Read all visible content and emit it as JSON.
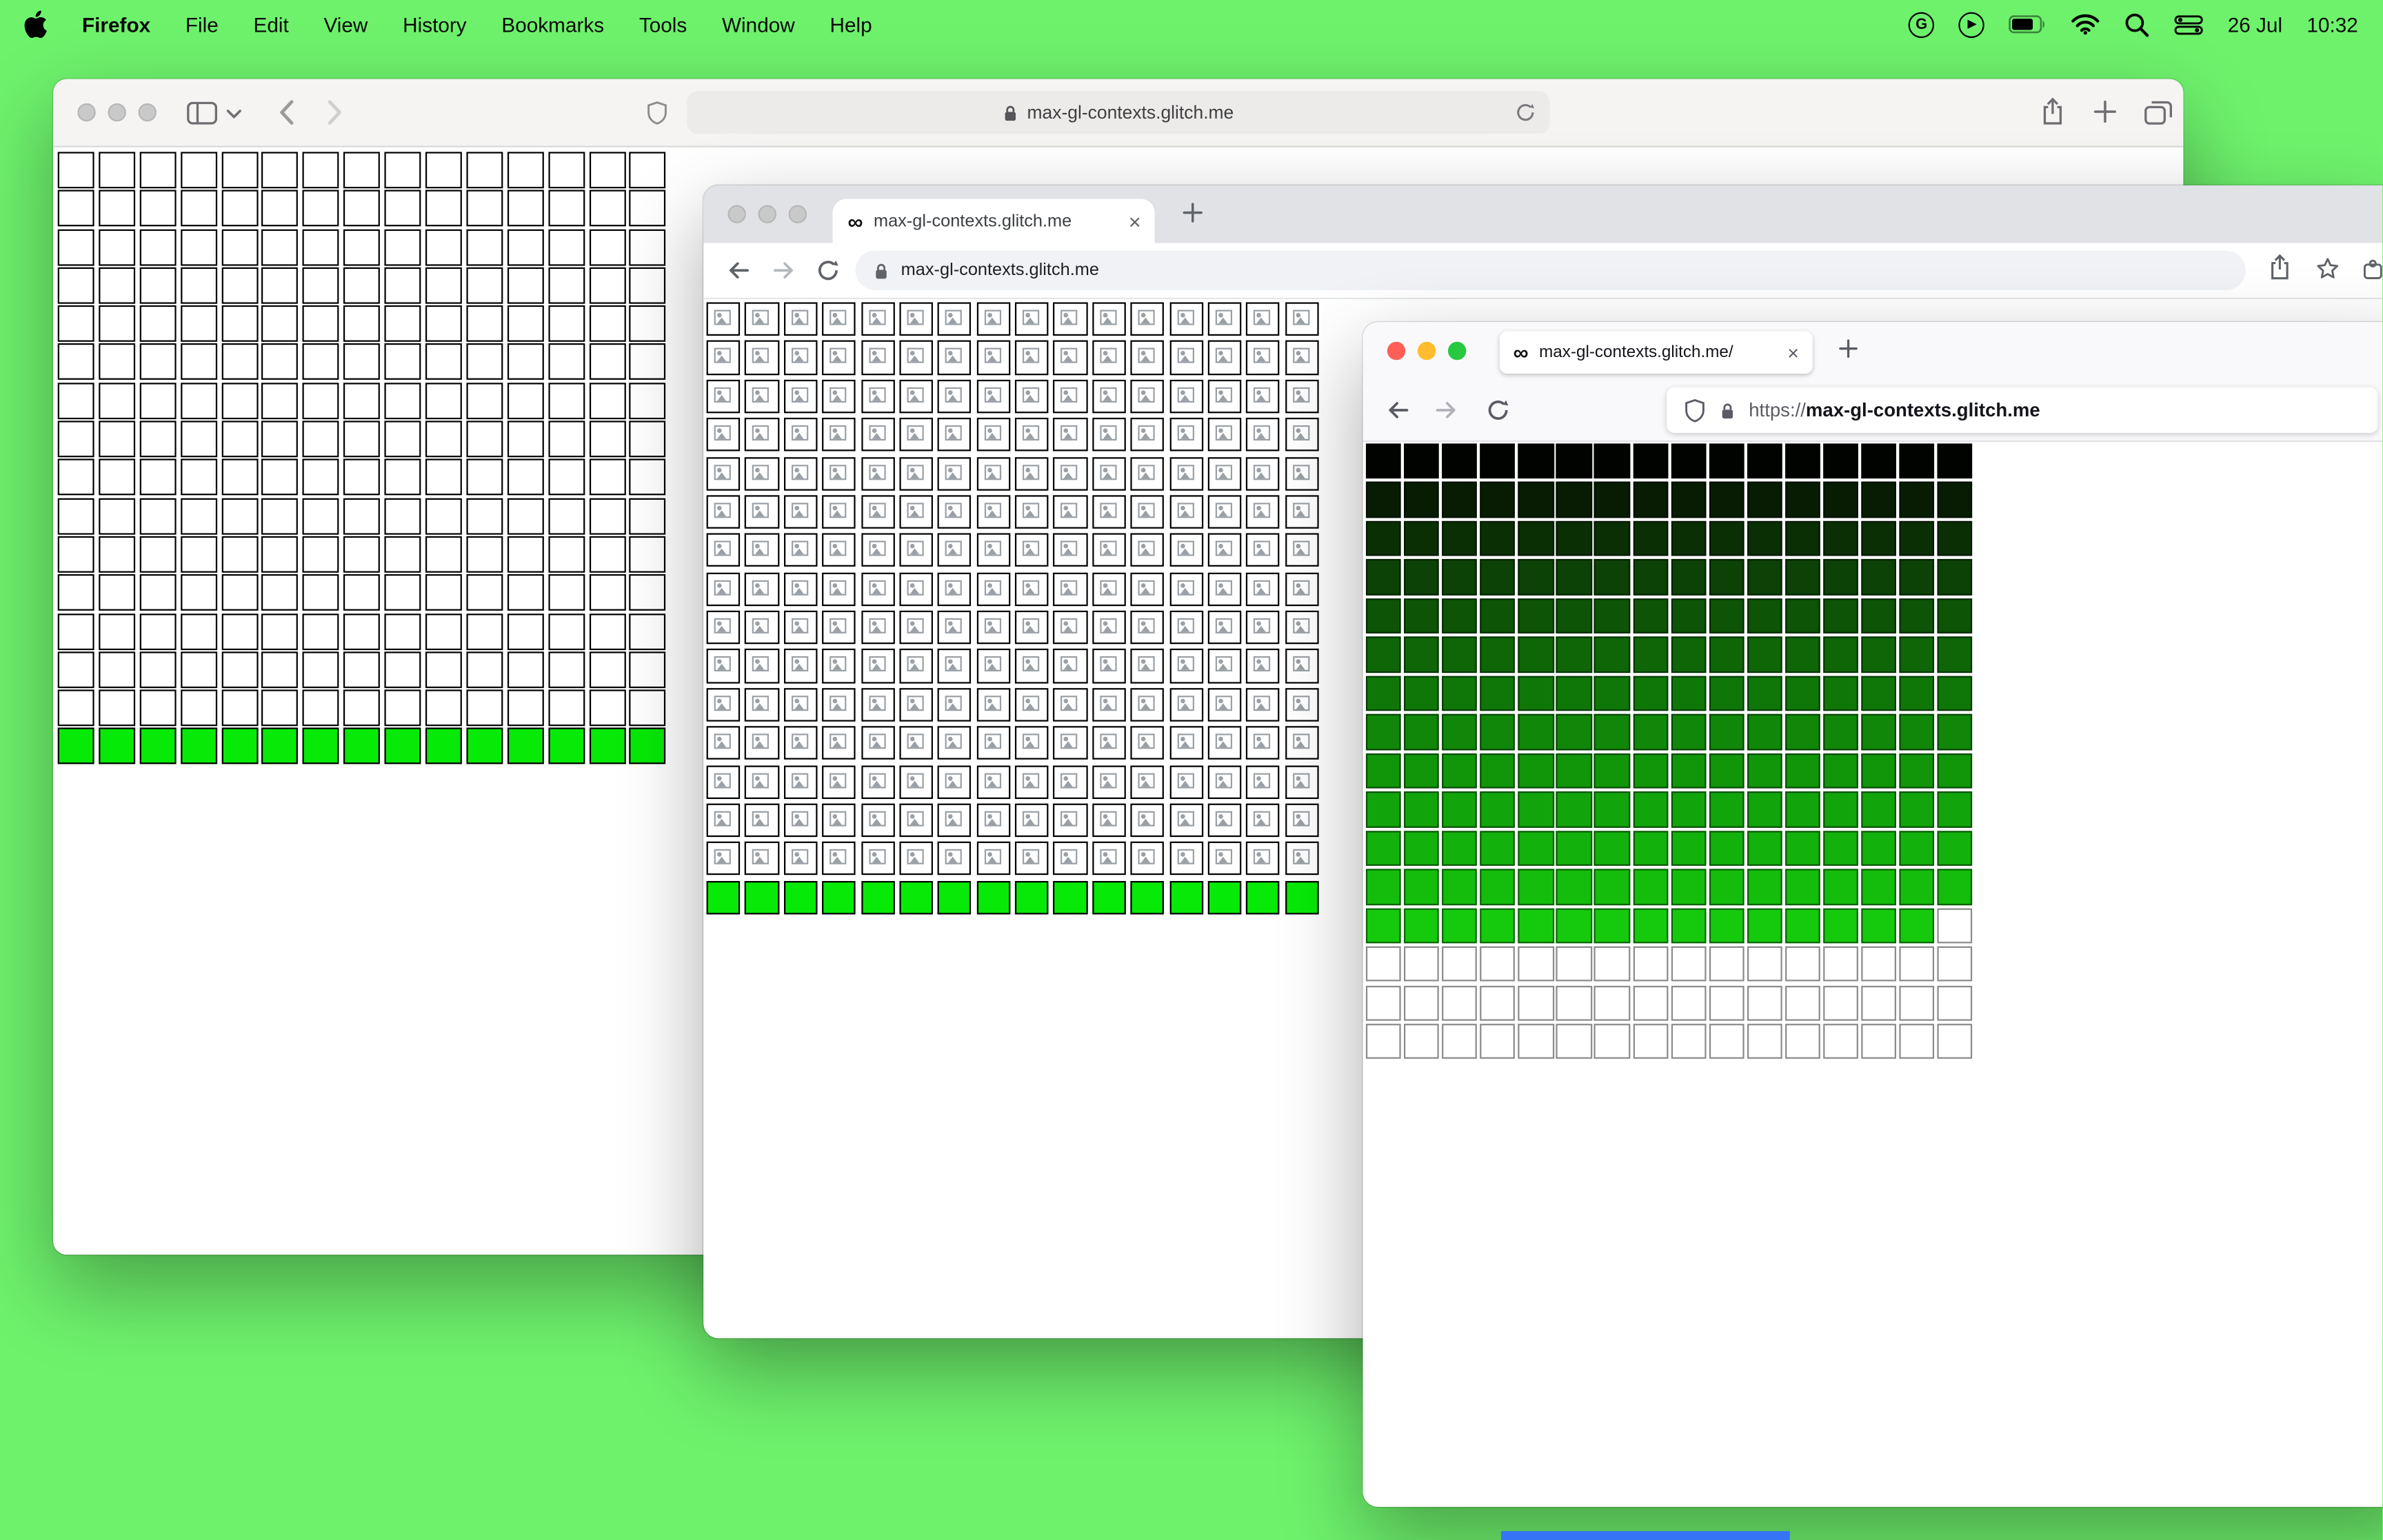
{
  "desktop": {
    "background_color": "#6ef26c",
    "bottom_strip_color": "#3575f5"
  },
  "menubar": {
    "app_name": "Firefox",
    "items": [
      "File",
      "Edit",
      "View",
      "History",
      "Bookmarks",
      "Tools",
      "Window",
      "Help"
    ],
    "status": {
      "google_label": "G",
      "date": "26 Jul",
      "time": "10:32"
    }
  },
  "safari": {
    "url": "max-gl-contexts.glitch.me"
  },
  "chrome": {
    "favicon": "∞",
    "tab_title": "max-gl-contexts.glitch.me",
    "close_label": "×",
    "url": "max-gl-contexts.glitch.me"
  },
  "firefox": {
    "favicon": "∞",
    "tab_title": "max-gl-contexts.glitch.me/",
    "close_label": "×",
    "url_scheme": "https://",
    "url_host": "max-gl-contexts.glitch.me"
  },
  "grids": {
    "safari": {
      "cols": 15,
      "cell": 24,
      "gapx": 2.9,
      "gapy": 1.3,
      "border": "#000000",
      "border_width": 1.5,
      "rows": [
        {
          "repeat": 15,
          "fill": "#ffffff"
        },
        {
          "repeat": 1,
          "fill": "#07e907"
        }
      ]
    },
    "chrome": {
      "cols": 16,
      "cell": 22.2,
      "gapx": 3.2,
      "gapy": 3.2,
      "border": "#000000",
      "border_width": 1.1,
      "rows": [
        {
          "repeat": 15,
          "fill": "#ffffff",
          "icon": true
        },
        {
          "repeat": 1,
          "fill": "#07e907"
        }
      ]
    },
    "firefox": {
      "cols": 16,
      "cell": 23.2,
      "gapx": 1.9,
      "gapy": 2.3,
      "border": "rgba(0,0,0,0.5)",
      "border_width": 1,
      "rows": [
        {
          "fill": "#010301"
        },
        {
          "fill": "#071c03"
        },
        {
          "fill": "#0a2f04"
        },
        {
          "fill": "#0c4205"
        },
        {
          "fill": "#0d5406"
        },
        {
          "fill": "#0e6607"
        },
        {
          "fill": "#0f7708"
        },
        {
          "fill": "#108709"
        },
        {
          "fill": "#11960a"
        },
        {
          "fill": "#12a40b"
        },
        {
          "fill": "#13b10b"
        },
        {
          "fill": "#14bd0c"
        },
        {
          "fill": "#15c90d",
          "last_cell_fill": "#ffffff",
          "last_cell_border": "#8a8a8a"
        },
        {
          "repeat": 3,
          "fill": "#ffffff",
          "border": "#8a8a8a"
        }
      ]
    }
  }
}
